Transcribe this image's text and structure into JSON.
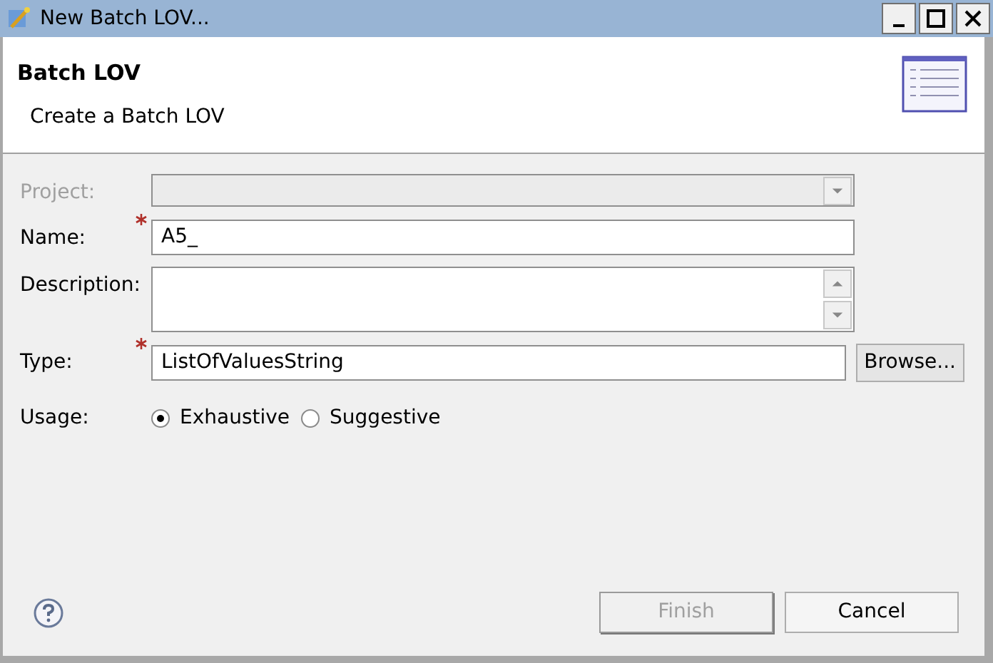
{
  "window": {
    "title": "New Batch LOV..."
  },
  "header": {
    "title": "Batch LOV",
    "subtitle": "Create a Batch LOV"
  },
  "fields": [
    {
      "kind": "combo",
      "label": "Project:",
      "disabled": true,
      "required": false
    },
    {
      "kind": "text",
      "label": "Name:",
      "disabled": false,
      "required": true,
      "value": "A5_"
    },
    {
      "kind": "textarea",
      "label": "Description:",
      "disabled": false,
      "required": false
    },
    {
      "kind": "browse",
      "label": "Type:",
      "disabled": false,
      "required": true,
      "value": "ListOfValuesString",
      "button": "Browse..."
    }
  ],
  "usage": {
    "label": "Usage:",
    "options": [
      {
        "label": "Exhaustive",
        "selected": true
      },
      {
        "label": "Suggestive",
        "selected": false
      }
    ]
  },
  "buttons": [
    {
      "label": "Finish",
      "disabled": true
    },
    {
      "label": "Cancel",
      "disabled": false
    }
  ]
}
